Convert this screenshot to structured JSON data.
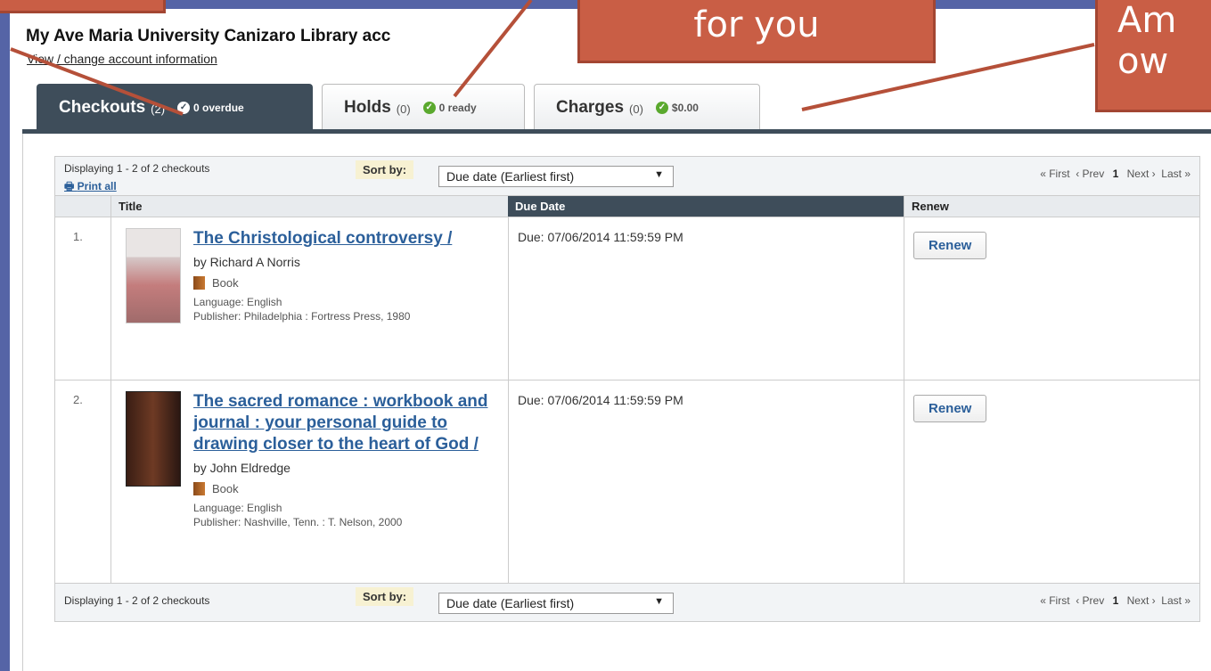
{
  "header": {
    "account_title": "My Ave Maria University Canizaro Library acc",
    "account_link": "View / change account information"
  },
  "tabs": [
    {
      "name": "Checkouts",
      "count": "(2)",
      "status": "0 overdue"
    },
    {
      "name": "Holds",
      "count": "(0)",
      "status": "0 ready"
    },
    {
      "name": "Charges",
      "count": "(0)",
      "status": "$0.00"
    }
  ],
  "callouts": {
    "top_center": "for you",
    "top_right": "Am\now"
  },
  "table": {
    "top_bar": {
      "displaying": "Displaying 1 - 2 of 2 checkouts",
      "print_all": "Print all",
      "sort_label": "Sort by:",
      "sort_value": "Due date (Earliest first)",
      "pager": {
        "first": "« First",
        "prev": "‹ Prev",
        "page": "1",
        "next": "Next ›",
        "last": "Last »"
      }
    },
    "columns": {
      "title": "Title",
      "due": "Due Date",
      "renew": "Renew"
    },
    "rows": [
      {
        "num": "1.",
        "title": "The Christological controversy /",
        "by": "by Richard A Norris",
        "format": "Book",
        "language": "Language: English",
        "publisher": "Publisher: Philadelphia : Fortress Press,  1980",
        "due": "Due: 07/06/2014 11:59:59 PM",
        "renew_label": "Renew"
      },
      {
        "num": "2.",
        "title": "The sacred romance : workbook and journal : your personal guide to drawing closer to the heart of God /",
        "by": "by John Eldredge",
        "format": "Book",
        "language": "Language: English",
        "publisher": "Publisher: Nashville, Tenn. : T. Nelson,  2000",
        "due": "Due: 07/06/2014 11:59:59 PM",
        "renew_label": "Renew"
      }
    ],
    "bottom_bar": {
      "displaying": "Displaying 1 - 2 of 2 checkouts",
      "sort_label": "Sort by:",
      "sort_value": "Due date (Earliest first)",
      "pager": {
        "first": "« First",
        "prev": "‹ Prev",
        "page": "1",
        "next": "Next ›",
        "last": "Last »"
      }
    }
  },
  "colors": {
    "accent": "#3e4d5a",
    "callout": "#c95e45",
    "link": "#2b5f9a",
    "slide_edge": "#5564a6"
  }
}
